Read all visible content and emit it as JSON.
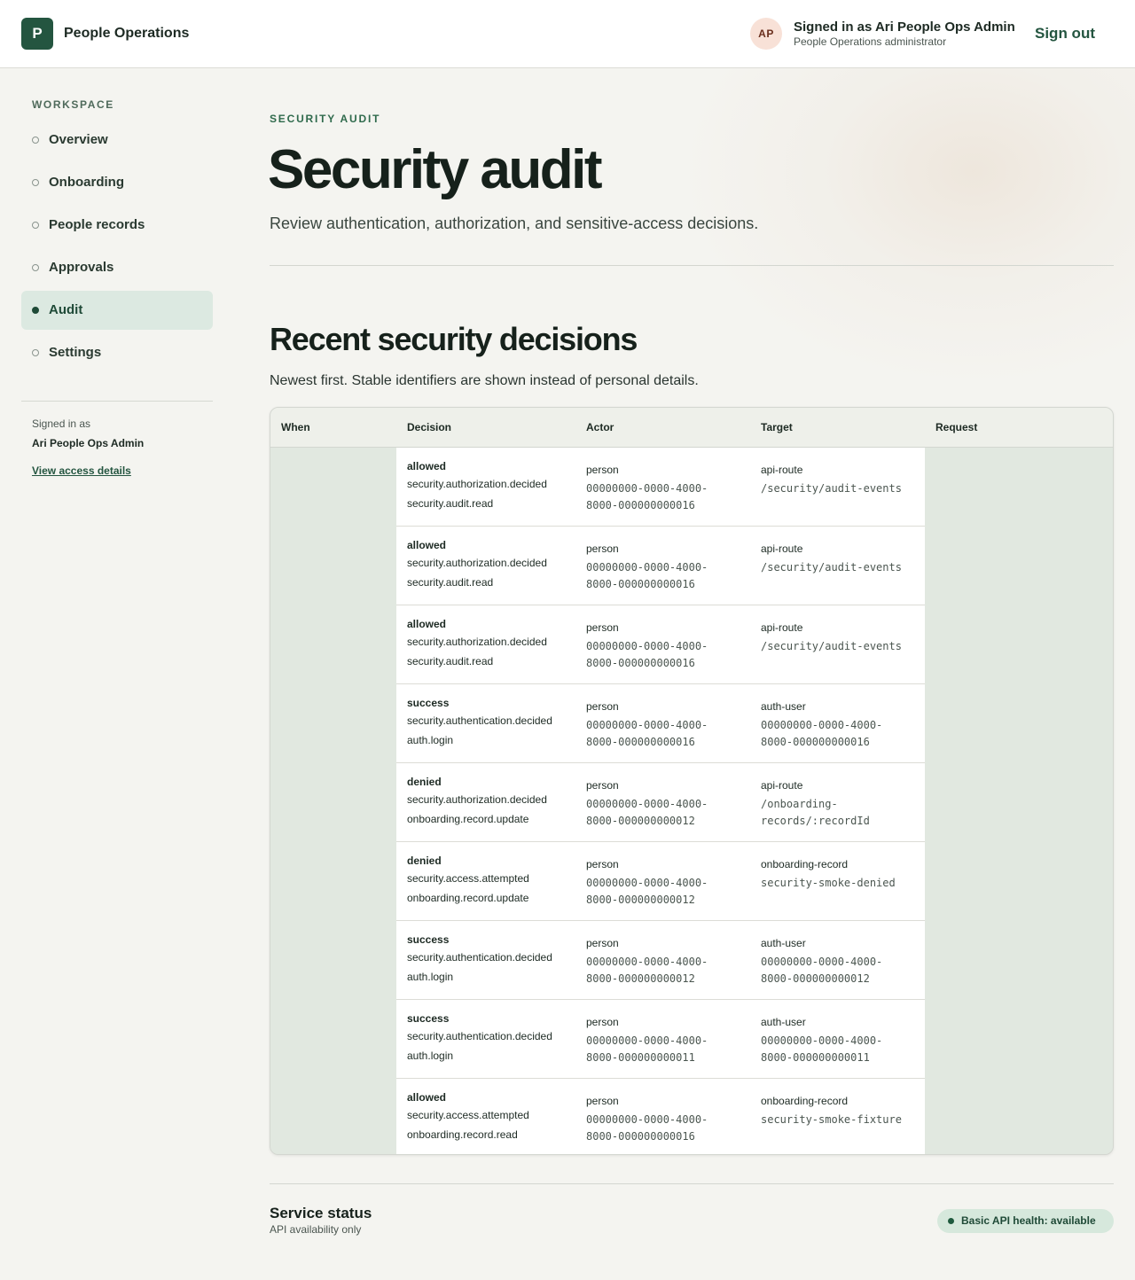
{
  "header": {
    "logo_letter": "P",
    "app_name": "People Operations",
    "avatar_initials": "AP",
    "user_title": "Signed in as Ari People Ops Admin",
    "user_role": "People Operations administrator",
    "sign_out_label": "Sign out"
  },
  "sidebar": {
    "heading": "WORKSPACE",
    "items": [
      {
        "label": "Overview",
        "active": false
      },
      {
        "label": "Onboarding",
        "active": false
      },
      {
        "label": "People records",
        "active": false
      },
      {
        "label": "Approvals",
        "active": false
      },
      {
        "label": "Audit",
        "active": true
      },
      {
        "label": "Settings",
        "active": false
      }
    ],
    "signed_in_label": "Signed in as",
    "signed_in_name": "Ari People Ops Admin",
    "access_link": "View access details"
  },
  "page": {
    "eyebrow": "SECURITY AUDIT",
    "title": "Security audit",
    "subtitle": "Review authentication, authorization, and sensitive-access decisions."
  },
  "section": {
    "title": "Recent security decisions",
    "subtitle": "Newest first. Stable identifiers are shown instead of personal details."
  },
  "table": {
    "headers": [
      "When",
      "Decision",
      "Actor",
      "Target",
      "Request"
    ],
    "rows": [
      {
        "when": "",
        "outcome": "allowed",
        "event": "security.authorization.decided",
        "action": "security.audit.read",
        "actor_type": "person",
        "actor_id": "00000000-0000-4000-8000-000000000016",
        "target_type": "api-route",
        "target_id": "/security/audit-events",
        "request": ""
      },
      {
        "when": "",
        "outcome": "allowed",
        "event": "security.authorization.decided",
        "action": "security.audit.read",
        "actor_type": "person",
        "actor_id": "00000000-0000-4000-8000-000000000016",
        "target_type": "api-route",
        "target_id": "/security/audit-events",
        "request": ""
      },
      {
        "when": "",
        "outcome": "allowed",
        "event": "security.authorization.decided",
        "action": "security.audit.read",
        "actor_type": "person",
        "actor_id": "00000000-0000-4000-8000-000000000016",
        "target_type": "api-route",
        "target_id": "/security/audit-events",
        "request": ""
      },
      {
        "when": "",
        "outcome": "success",
        "event": "security.authentication.decided",
        "action": "auth.login",
        "actor_type": "person",
        "actor_id": "00000000-0000-4000-8000-000000000016",
        "target_type": "auth-user",
        "target_id": "00000000-0000-4000-8000-000000000016",
        "request": ""
      },
      {
        "when": "",
        "outcome": "denied",
        "event": "security.authorization.decided",
        "action": "onboarding.record.update",
        "actor_type": "person",
        "actor_id": "00000000-0000-4000-8000-000000000012",
        "target_type": "api-route",
        "target_id": "/onboarding-records/:recordId",
        "request": ""
      },
      {
        "when": "",
        "outcome": "denied",
        "event": "security.access.attempted",
        "action": "onboarding.record.update",
        "actor_type": "person",
        "actor_id": "00000000-0000-4000-8000-000000000012",
        "target_type": "onboarding-record",
        "target_id": "security-smoke-denied",
        "request": ""
      },
      {
        "when": "",
        "outcome": "success",
        "event": "security.authentication.decided",
        "action": "auth.login",
        "actor_type": "person",
        "actor_id": "00000000-0000-4000-8000-000000000012",
        "target_type": "auth-user",
        "target_id": "00000000-0000-4000-8000-000000000012",
        "request": ""
      },
      {
        "when": "",
        "outcome": "success",
        "event": "security.authentication.decided",
        "action": "auth.login",
        "actor_type": "person",
        "actor_id": "00000000-0000-4000-8000-000000000011",
        "target_type": "auth-user",
        "target_id": "00000000-0000-4000-8000-000000000011",
        "request": ""
      },
      {
        "when": "",
        "outcome": "allowed",
        "event": "security.access.attempted",
        "action": "onboarding.record.read",
        "actor_type": "person",
        "actor_id": "00000000-0000-4000-8000-000000000016",
        "target_type": "onboarding-record",
        "target_id": "security-smoke-fixture",
        "request": ""
      }
    ]
  },
  "footer": {
    "service_title": "Service status",
    "service_sub": "API availability only",
    "health_badge": "Basic API health: available"
  }
}
